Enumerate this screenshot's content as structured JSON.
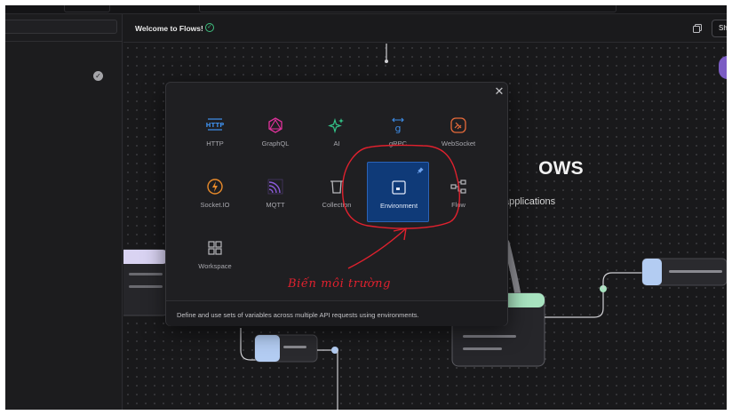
{
  "header": {
    "tab_title": "Welcome to Flows!",
    "verified_icon": "check-circle-icon",
    "copy_icon": "copy-icon",
    "share_label": "Share"
  },
  "sidebar": {
    "status_icon": "check-circle-icon"
  },
  "canvas": {
    "hero_title": "Flows",
    "hero_subtitle": "applications"
  },
  "modal": {
    "close_icon": "close-icon",
    "tiles": [
      {
        "label": "HTTP",
        "icon": "http-icon",
        "color": "#3d8ce6"
      },
      {
        "label": "GraphQL",
        "icon": "graphql-icon",
        "color": "#e0329c"
      },
      {
        "label": "AI",
        "icon": "ai-sparkle-icon",
        "color": "#33c58a"
      },
      {
        "label": "gRPC",
        "icon": "grpc-icon",
        "color": "#3d8ce6"
      },
      {
        "label": "WebSocket",
        "icon": "websocket-icon",
        "color": "#e86a3a"
      },
      {
        "label": "Socket.IO",
        "icon": "socketio-icon",
        "color": "#e88a2a"
      },
      {
        "label": "MQTT",
        "icon": "mqtt-icon",
        "color": "#8a5ad8"
      },
      {
        "label": "Collection",
        "icon": "collection-icon",
        "color": "#b8b8bc"
      },
      {
        "label": "Environment",
        "icon": "environment-icon",
        "color": "#dfe7f7"
      },
      {
        "label": "Flow",
        "icon": "flow-icon",
        "color": "#b8b8bc"
      },
      {
        "label": "Workspace",
        "icon": "workspace-icon",
        "color": "#b8b8bc"
      }
    ],
    "selected": "Environment",
    "footer": "Define and use sets of variables across multiple API requests using environments."
  },
  "annotation": {
    "text": "Biến môi trường",
    "color": "#e0212e"
  }
}
